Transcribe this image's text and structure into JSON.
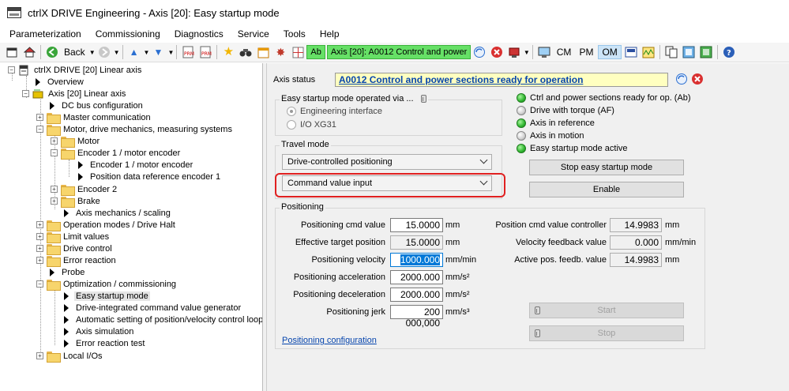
{
  "window": {
    "title": "ctrlX DRIVE Engineering - Axis [20]: Easy startup mode"
  },
  "menu": [
    "Parameterization",
    "Commissioning",
    "Diagnostics",
    "Service",
    "Tools",
    "Help"
  ],
  "toolbar": {
    "back_label": "Back",
    "ab_badge": "Ab",
    "axis_status_text": "Axis [20]:    A0012 Control and power",
    "modes": [
      "CM",
      "PM",
      "OM"
    ],
    "active_mode": "OM",
    "status_color": "#66e066"
  },
  "tree": {
    "items": [
      {
        "label": "ctrlX DRIVE [20] Linear axis"
      },
      {
        "label": "Overview"
      },
      {
        "label": "Axis [20] Linear axis"
      },
      {
        "label": "DC bus configuration"
      },
      {
        "label": "Master communication"
      },
      {
        "label": "Motor, drive mechanics, measuring systems"
      },
      {
        "label": "Motor"
      },
      {
        "label": "Encoder 1 / motor encoder"
      },
      {
        "label": "Encoder 1 / motor encoder"
      },
      {
        "label": "Position data reference encoder 1"
      },
      {
        "label": "Encoder 2"
      },
      {
        "label": "Brake"
      },
      {
        "label": "Axis mechanics / scaling"
      },
      {
        "label": "Operation modes / Drive Halt"
      },
      {
        "label": "Limit values"
      },
      {
        "label": "Drive control"
      },
      {
        "label": "Error reaction"
      },
      {
        "label": "Probe"
      },
      {
        "label": "Optimization / commissioning"
      },
      {
        "label": "Easy startup mode"
      },
      {
        "label": "Drive-integrated command value generator"
      },
      {
        "label": "Automatic setting of position/velocity control loop..."
      },
      {
        "label": "Axis simulation"
      },
      {
        "label": "Error reaction test"
      },
      {
        "label": "Local I/Os"
      }
    ]
  },
  "main": {
    "axis_status_label": "Axis status",
    "axis_status_value": "A0012 Control and power sections ready for operation",
    "operated_via": {
      "title": "Easy startup mode operated via ...",
      "options": [
        "Engineering interface",
        "I/O XG31"
      ]
    },
    "travel_mode": {
      "title": "Travel mode",
      "dropdown1": "Drive-controlled positioning",
      "dropdown2": "Command value input"
    },
    "status_leds": [
      {
        "label": "Ctrl and power sections ready for op. (Ab)",
        "state": "green"
      },
      {
        "label": "Drive with torque (AF)",
        "state": "grey"
      },
      {
        "label": "Axis in reference",
        "state": "green"
      },
      {
        "label": "Axis in motion",
        "state": "grey"
      },
      {
        "label": "Easy startup mode active",
        "state": "green"
      }
    ],
    "buttons": {
      "stop_easy": "Stop easy startup mode",
      "enable": "Enable",
      "start": "Start",
      "stop": "Stop"
    },
    "positioning": {
      "title": "Positioning",
      "fields": [
        {
          "label": "Positioning cmd value",
          "value": "15.0000",
          "unit": "mm"
        },
        {
          "label": "Effective target position",
          "value": "15.0000",
          "unit": "mm"
        },
        {
          "label": "Positioning velocity",
          "value": "1000.000",
          "unit": "mm/min"
        },
        {
          "label": "Positioning acceleration",
          "value": "2000.000",
          "unit": "mm/s²"
        },
        {
          "label": "Positioning deceleration",
          "value": "2000.000",
          "unit": "mm/s²"
        },
        {
          "label": "Positioning jerk",
          "value": "200 000,000",
          "unit": "mm/s³"
        }
      ],
      "right_fields": [
        {
          "label": "Position cmd value controller",
          "value": "14.9983",
          "unit": "mm"
        },
        {
          "label": "Velocity feedback value",
          "value": "0.000",
          "unit": "mm/min"
        },
        {
          "label": "Active pos. feedb. value",
          "value": "14.9983",
          "unit": "mm"
        }
      ],
      "config_link": "Positioning configuration"
    }
  }
}
